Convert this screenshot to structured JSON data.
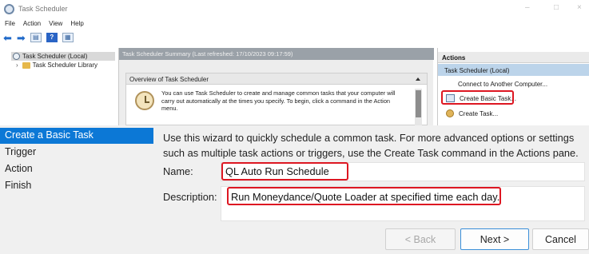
{
  "window": {
    "title": "Task Scheduler",
    "controls": [
      "–",
      "□",
      "×"
    ]
  },
  "menubar": [
    "File",
    "Action",
    "View",
    "Help"
  ],
  "tree": {
    "root": "Task Scheduler (Local)",
    "child": "Task Scheduler Library"
  },
  "summary": {
    "header": "Task Scheduler Summary (Last refreshed: 17/10/2023 09:17:59)",
    "overview_title": "Overview of Task Scheduler",
    "overview_text": "You can use Task Scheduler to create and manage common tasks that your computer will carry out automatically at the times you specify. To begin, click a command in the Action menu."
  },
  "actions": {
    "title": "Actions",
    "group": "Task Scheduler (Local)",
    "items": [
      "Connect to Another Computer...",
      "Create Basic Task...",
      "Create Task..."
    ]
  },
  "wizard": {
    "nav": [
      "Create a Basic Task",
      "Trigger",
      "Action",
      "Finish"
    ],
    "intro": "Use this wizard to quickly schedule a common task.  For more advanced options or settings such as multiple task actions or triggers, use the Create Task command in the Actions pane.",
    "name_label": "Name:",
    "name_value": "QL Auto Run Schedule",
    "description_label": "Description:",
    "description_value": "Run Moneydance/Quote Loader at specified time each day.",
    "buttons": {
      "back": "< Back",
      "next": "Next >",
      "cancel": "Cancel"
    }
  },
  "colors": {
    "highlight_box": "#dd1722",
    "wizard_nav_active": "#0c78d6",
    "actions_group_bg": "#bcd4ea"
  }
}
